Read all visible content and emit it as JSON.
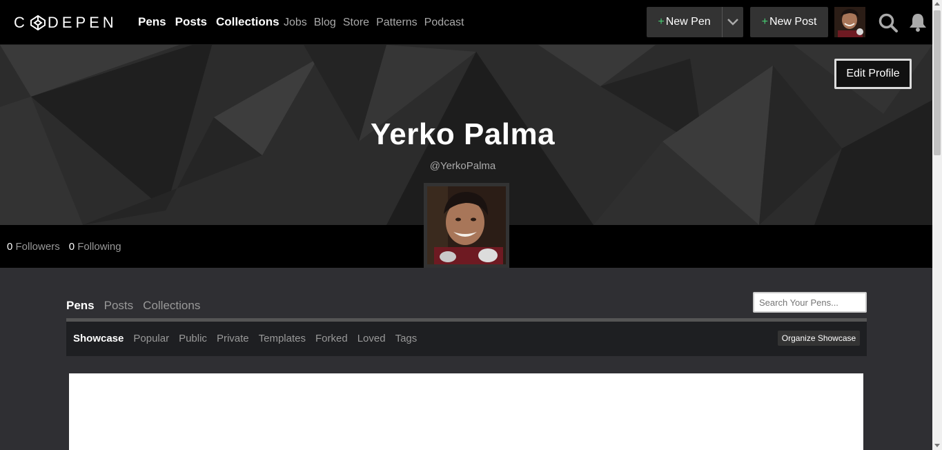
{
  "brand": {
    "logo_text": "CODEPEN"
  },
  "nav": {
    "main": [
      "Pens",
      "Posts",
      "Collections"
    ],
    "secondary": [
      "Jobs",
      "Blog",
      "Store",
      "Patterns",
      "Podcast"
    ]
  },
  "actions": {
    "new_pen": "New Pen",
    "new_post": "New Post",
    "plus": "+"
  },
  "profile": {
    "name": "Yerko Palma",
    "handle": "@YerkoPalma",
    "edit_label": "Edit Profile",
    "followers_count": "0",
    "followers_label": "Followers",
    "following_count": "0",
    "following_label": "Following"
  },
  "content": {
    "tabs": [
      "Pens",
      "Posts",
      "Collections"
    ],
    "active_tab": "Pens",
    "search_placeholder": "Search Your Pens...",
    "filters": [
      "Showcase",
      "Popular",
      "Public",
      "Private",
      "Templates",
      "Forked",
      "Loved",
      "Tags"
    ],
    "active_filter": "Showcase",
    "organize_label": "Organize Showcase"
  },
  "colors": {
    "accent_plus": "#47cf73",
    "topbar": "#000000",
    "page_bg": "#2f2f33"
  }
}
